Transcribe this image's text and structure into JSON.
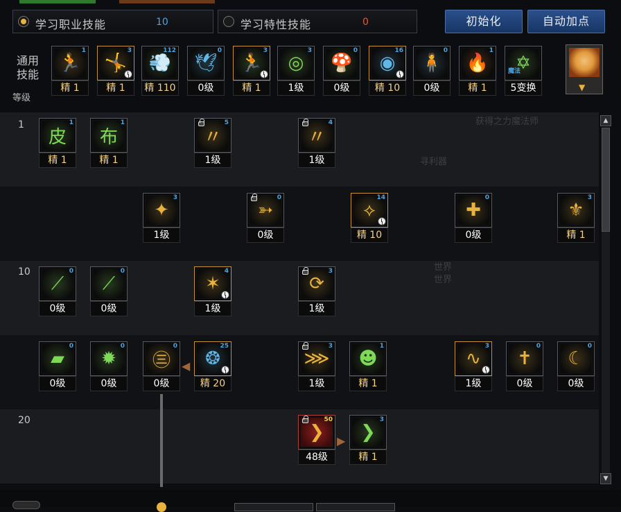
{
  "tabs": {
    "class_skills": {
      "label": "学习职业技能",
      "count": "10"
    },
    "trait_skills": {
      "label": "学习特性技能",
      "count": "0"
    }
  },
  "buttons": {
    "reset": "初始化",
    "auto_add": "自动加点"
  },
  "common": {
    "label": "通用技能",
    "level_header": "等级",
    "skills": [
      {
        "sp": "1",
        "level": "精 1",
        "glyph": "🏃",
        "color": "#e8b23c",
        "frame": "normal",
        "clock": false
      },
      {
        "sp": "3",
        "level": "精 1",
        "glyph": "🤸",
        "color": "#e8b23c",
        "frame": "gold",
        "clock": true
      },
      {
        "sp": "112",
        "level": "精 110",
        "glyph": "💨",
        "color": "#7ed957",
        "frame": "normal",
        "clock": false
      },
      {
        "sp": "0",
        "level": "0级",
        "glyph": "🕊",
        "color": "#5fb8e8",
        "frame": "normal",
        "clock": false
      },
      {
        "sp": "3",
        "level": "精 1",
        "glyph": "🏃",
        "color": "#7ed957",
        "frame": "gold",
        "clock": true
      },
      {
        "sp": "3",
        "level": "1级",
        "glyph": "◎",
        "color": "#7ed957",
        "frame": "normal",
        "clock": false
      },
      {
        "sp": "0",
        "level": "0级",
        "glyph": "🍄",
        "color": "#7ed957",
        "frame": "normal",
        "clock": false
      },
      {
        "sp": "16",
        "level": "精 10",
        "glyph": "◉",
        "color": "#5fb8e8",
        "frame": "gold",
        "clock": true
      },
      {
        "sp": "0",
        "level": "0级",
        "glyph": "🧍",
        "color": "#5fb8e8",
        "frame": "normal",
        "clock": false
      },
      {
        "sp": "1",
        "level": "精 1",
        "glyph": "🔥",
        "color": "#ff8a2a",
        "frame": "normal",
        "clock": false
      },
      {
        "sp": "魔法",
        "level": "5变换",
        "glyph": "✡",
        "color": "#7ed957",
        "frame": "normal",
        "clock": false
      }
    ]
  },
  "tree": {
    "levels": [
      "1",
      "10",
      "20"
    ],
    "rows": [
      [
        {
          "sp": "1",
          "level": "精 1",
          "glyph": "皮",
          "color": "#7ed957",
          "frame": "normal",
          "lock": false,
          "clock": false
        },
        {
          "sp": "1",
          "level": "精 1",
          "glyph": "布",
          "color": "#7ed957",
          "frame": "normal",
          "lock": false,
          "clock": false
        },
        {
          "sp": "5",
          "level": "1级",
          "glyph": "〃",
          "color": "#e8b23c",
          "frame": "normal",
          "lock": true,
          "clock": false
        },
        {
          "sp": "4",
          "level": "1级",
          "glyph": "〃",
          "color": "#e8b23c",
          "frame": "normal",
          "lock": true,
          "clock": false
        }
      ],
      [
        {
          "sp": "3",
          "level": "1级",
          "glyph": "✦",
          "color": "#e8b23c",
          "frame": "normal",
          "lock": false,
          "clock": false
        },
        {
          "sp": "0",
          "level": "0级",
          "glyph": "➳",
          "color": "#e8b23c",
          "frame": "normal",
          "lock": true,
          "clock": false
        },
        {
          "sp": "14",
          "level": "精 10",
          "glyph": "⟡",
          "color": "#e8b23c",
          "frame": "gold",
          "lock": false,
          "clock": true
        },
        {
          "sp": "0",
          "level": "0级",
          "glyph": "✚",
          "color": "#e8b23c",
          "frame": "normal",
          "lock": false,
          "clock": false
        },
        {
          "sp": "3",
          "level": "精 1",
          "glyph": "⚜",
          "color": "#e8b23c",
          "frame": "normal",
          "lock": false,
          "clock": false
        }
      ],
      [
        {
          "sp": "0",
          "level": "0级",
          "glyph": "⟋",
          "color": "#7ed957",
          "frame": "normal",
          "lock": false,
          "clock": false
        },
        {
          "sp": "0",
          "level": "0级",
          "glyph": "⟋",
          "color": "#7ed957",
          "frame": "normal",
          "lock": false,
          "clock": false
        },
        {
          "sp": "4",
          "level": "1级",
          "glyph": "✶",
          "color": "#e8b23c",
          "frame": "gold",
          "lock": false,
          "clock": true
        },
        {
          "sp": "3",
          "level": "1级",
          "glyph": "⟳",
          "color": "#e8b23c",
          "frame": "normal",
          "lock": true,
          "clock": false
        }
      ],
      [
        {
          "sp": "0",
          "level": "0级",
          "glyph": "▰",
          "color": "#7ed957",
          "frame": "normal",
          "lock": false,
          "clock": false
        },
        {
          "sp": "0",
          "level": "0级",
          "glyph": "✹",
          "color": "#7ed957",
          "frame": "normal",
          "lock": false,
          "clock": false
        },
        {
          "sp": "0",
          "level": "0级",
          "glyph": "㊂",
          "color": "#e8b23c",
          "frame": "normal",
          "lock": false,
          "clock": false
        },
        {
          "sp": "25",
          "level": "精 20",
          "glyph": "❂",
          "color": "#5fb8e8",
          "frame": "gold",
          "lock": false,
          "clock": true
        },
        {
          "sp": "3",
          "level": "1级",
          "glyph": "⋙",
          "color": "#e8b23c",
          "frame": "normal",
          "lock": true,
          "clock": false
        },
        {
          "sp": "1",
          "level": "精 1",
          "glyph": "☻",
          "color": "#7ed957",
          "frame": "normal",
          "lock": false,
          "clock": false
        },
        {
          "sp": "3",
          "level": "1级",
          "glyph": "∿",
          "color": "#e8b23c",
          "frame": "gold",
          "lock": false,
          "clock": true
        },
        {
          "sp": "0",
          "level": "0级",
          "glyph": "✝",
          "color": "#e8b23c",
          "frame": "normal",
          "lock": false,
          "clock": false
        },
        {
          "sp": "0",
          "level": "0级",
          "glyph": "☾",
          "color": "#e8b23c",
          "frame": "normal",
          "lock": false,
          "clock": false
        }
      ],
      [
        {
          "sp": "50",
          "level": "48级",
          "glyph": "❯",
          "color": "#e8b23c",
          "frame": "red",
          "lock": true,
          "clock": false
        },
        {
          "sp": "3",
          "level": "精 1",
          "glyph": "❯",
          "color": "#7ed957",
          "frame": "normal",
          "lock": false,
          "clock": false
        }
      ]
    ]
  },
  "background": {
    "t1": "获得之力魔法师",
    "t2": "寻利器",
    "t3": "世界",
    "t4": "世界"
  }
}
